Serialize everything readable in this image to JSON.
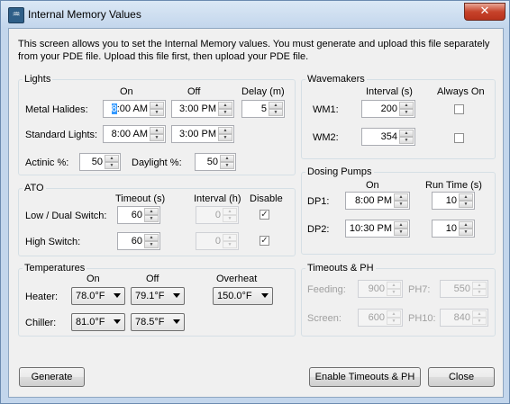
{
  "window": {
    "title": "Internal Memory Values",
    "icon_glyph": "♒",
    "close_glyph": "✕"
  },
  "description": "This screen allows you to set the Internal Memory values. You must generate and upload this file separately from your PDE file.  Upload this file first, then upload your PDE file.",
  "lights": {
    "legend": "Lights",
    "col_on": "On",
    "col_off": "Off",
    "col_delay": "Delay (m)",
    "metal_halides_label": "Metal Halides:",
    "metal_halides_on_sel": "8",
    "metal_halides_on": ":00 AM",
    "metal_halides_off": "3:00 PM",
    "metal_halides_delay": "5",
    "standard_lights_label": "Standard Lights:",
    "standard_on": "8:00 AM",
    "standard_off": "3:00 PM",
    "actinic_label": "Actinic %:",
    "actinic_value": "50",
    "daylight_label": "Daylight %:",
    "daylight_value": "50"
  },
  "ato": {
    "legend": "ATO",
    "col_timeout": "Timeout (s)",
    "col_interval": "Interval (h)",
    "col_disable": "Disable",
    "low_label": "Low / Dual Switch:",
    "low_timeout": "60",
    "low_interval": "0",
    "low_disable_checked": true,
    "high_label": "High Switch:",
    "high_timeout": "60",
    "high_interval": "0",
    "high_disable_checked": true
  },
  "temperatures": {
    "legend": "Temperatures",
    "col_on": "On",
    "col_off": "Off",
    "col_overheat": "Overheat",
    "heater_label": "Heater:",
    "heater_on": "78.0°F",
    "heater_off": "79.1°F",
    "overheat": "150.0°F",
    "chiller_label": "Chiller:",
    "chiller_on": "81.0°F",
    "chiller_off": "78.5°F"
  },
  "wavemakers": {
    "legend": "Wavemakers",
    "col_interval": "Interval (s)",
    "col_always_on": "Always On",
    "wm1_label": "WM1:",
    "wm1_interval": "200",
    "wm1_always_on": false,
    "wm2_label": "WM2:",
    "wm2_interval": "354",
    "wm2_always_on": false
  },
  "dosing": {
    "legend": "Dosing Pumps",
    "col_on": "On",
    "col_runtime": "Run Time (s)",
    "dp1_label": "DP1:",
    "dp1_on": "8:00 PM",
    "dp1_runtime": "10",
    "dp2_label": "DP2:",
    "dp2_on": "10:30 PM",
    "dp2_runtime": "10"
  },
  "timeouts_ph": {
    "legend": "Timeouts & PH",
    "feeding_label": "Feeding:",
    "feeding_value": "900",
    "ph7_label": "PH7:",
    "ph7_value": "550",
    "screen_label": "Screen:",
    "screen_value": "600",
    "ph10_label": "PH10:",
    "ph10_value": "840"
  },
  "buttons": {
    "generate": "Generate",
    "enable_timeouts": "Enable Timeouts & PH",
    "close": "Close"
  },
  "spin_glyphs": {
    "up": "▲",
    "down": "▼",
    "check": "✓"
  }
}
